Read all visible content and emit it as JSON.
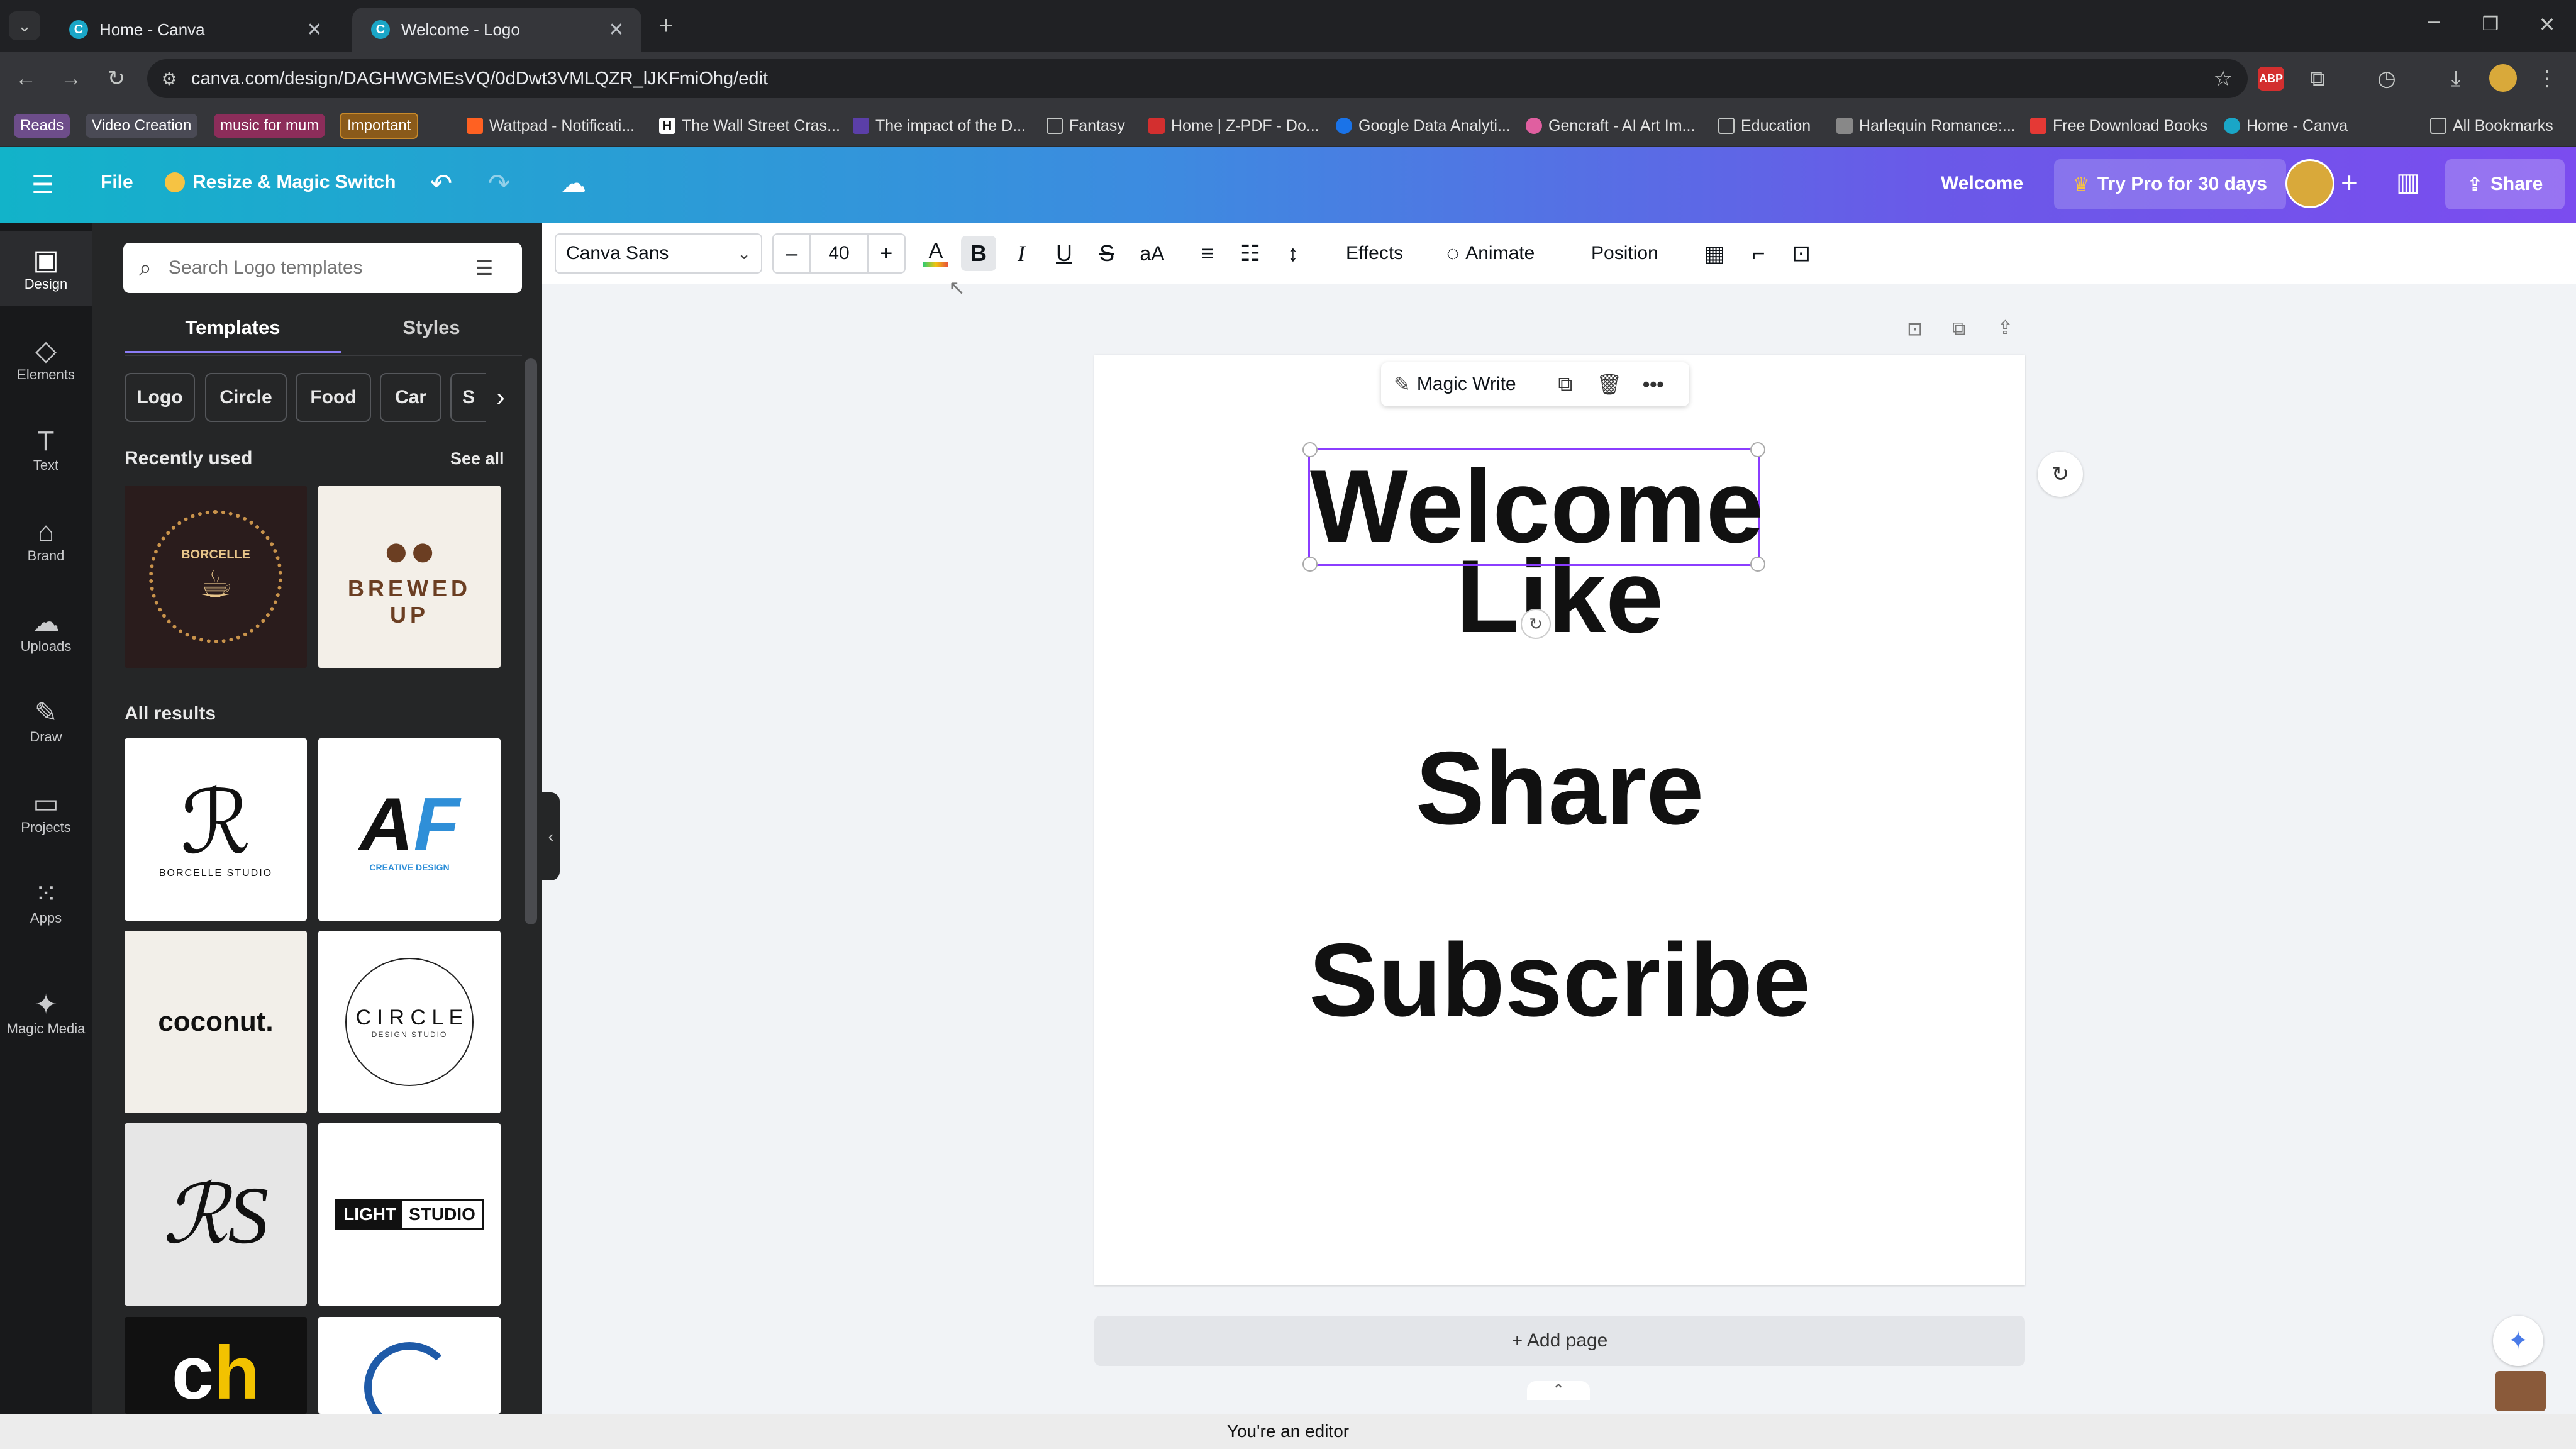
{
  "browser": {
    "tabs": [
      {
        "title": "Home - Canva",
        "active": false
      },
      {
        "title": "Welcome - Logo",
        "active": true
      }
    ],
    "url": "canva.com/design/DAGHWGMEsVQ/0dDwt3VMLQZR_lJKFmiOhg/edit",
    "bookmarks": [
      {
        "label": "Reads",
        "color": "#6d4d8a"
      },
      {
        "label": "Video Creation",
        "color": "#4a4a55"
      },
      {
        "label": "music for mum",
        "color": "#8c2d5a"
      },
      {
        "label": "Important",
        "color": "#8a5a1a"
      },
      {
        "label": "Wattpad - Notificati...",
        "color": "#ff6122"
      },
      {
        "label": "The Wall Street Cras...",
        "color": "#111111"
      },
      {
        "label": "The impact of the D...",
        "color": "#5b3fa8"
      },
      {
        "label": "Fantasy",
        "color": "folder"
      },
      {
        "label": "Home | Z-PDF - Do...",
        "color": "#d32f2f"
      },
      {
        "label": "Google Data Analyti...",
        "color": "#1a73e8"
      },
      {
        "label": "Gencraft - AI Art Im...",
        "color": "#e05fa0"
      },
      {
        "label": "Education",
        "color": "folder"
      },
      {
        "label": "Harlequin Romance:...",
        "color": "#888888"
      },
      {
        "label": "Free Download Books",
        "color": "#e53935"
      },
      {
        "label": "Home - Canva",
        "color": "#1aa6c7"
      }
    ],
    "all_bookmarks": "All Bookmarks"
  },
  "header": {
    "file": "File",
    "resize": "Resize & Magic Switch",
    "doc_title": "Welcome",
    "try_pro": "Try Pro for 30 days",
    "share": "Share"
  },
  "rail": [
    {
      "label": "Design",
      "icon": "design-icon",
      "glyph": "▣"
    },
    {
      "label": "Elements",
      "icon": "elements-icon",
      "glyph": "◇"
    },
    {
      "label": "Text",
      "icon": "text-icon",
      "glyph": "T"
    },
    {
      "label": "Brand",
      "icon": "brand-icon",
      "glyph": "⌂"
    },
    {
      "label": "Uploads",
      "icon": "uploads-icon",
      "glyph": "☁"
    },
    {
      "label": "Draw",
      "icon": "draw-icon",
      "glyph": "✎"
    },
    {
      "label": "Projects",
      "icon": "projects-icon",
      "glyph": "▭"
    },
    {
      "label": "Apps",
      "icon": "apps-icon",
      "glyph": "⁙"
    },
    {
      "label": "Magic Media",
      "icon": "magic-media-icon",
      "glyph": "✦"
    }
  ],
  "panel": {
    "search_placeholder": "Search Logo templates",
    "tabs": [
      "Templates",
      "Styles"
    ],
    "pills": [
      "Logo",
      "Circle",
      "Food",
      "Car",
      "S"
    ],
    "recently_used": "Recently used",
    "see_all": "See all",
    "all_results": "All results",
    "thumbs": {
      "borcelle": "BORCELLE",
      "brewed": "BREWED UP",
      "borcelle_studio": "BORCELLE STUDIO",
      "creative": "CREATIVE DESIGN",
      "coconut": "coconut.",
      "circle": "C I R C L E",
      "circle_sub": "DESIGN STUDIO",
      "light": "LIGHT",
      "studio": "STUDIO"
    }
  },
  "context_bar": {
    "font": "Canva Sans",
    "size": "40",
    "minus": "–",
    "plus": "+",
    "effects": "Effects",
    "animate": "Animate",
    "position": "Position"
  },
  "canvas": {
    "magic_write": "Magic Write",
    "lines": [
      "Welcome",
      "Like",
      "Share",
      "Subscribe"
    ],
    "add_page": "+ Add page"
  },
  "status": "You're an editor"
}
